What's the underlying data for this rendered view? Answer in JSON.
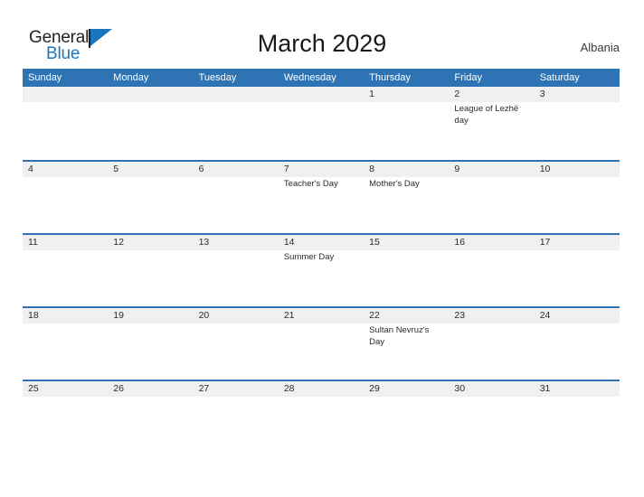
{
  "brand": {
    "name_part1": "General",
    "name_part2": "Blue",
    "logo_icon": "flag-triangle-icon",
    "color_dark": "#231f20",
    "color_blue": "#1a76bc"
  },
  "header": {
    "title": "March 2029",
    "country": "Albania",
    "accent_color": "#2e74b5",
    "band_color": "#f0f0f0"
  },
  "calendar": {
    "month": "March",
    "year": "2029",
    "weekday_headers": [
      "Sunday",
      "Monday",
      "Tuesday",
      "Wednesday",
      "Thursday",
      "Friday",
      "Saturday"
    ],
    "weeks": [
      {
        "days": [
          {
            "date": "",
            "event": ""
          },
          {
            "date": "",
            "event": ""
          },
          {
            "date": "",
            "event": ""
          },
          {
            "date": "",
            "event": ""
          },
          {
            "date": "1",
            "event": ""
          },
          {
            "date": "2",
            "event": "League of Lezhë day"
          },
          {
            "date": "3",
            "event": ""
          }
        ]
      },
      {
        "days": [
          {
            "date": "4",
            "event": ""
          },
          {
            "date": "5",
            "event": ""
          },
          {
            "date": "6",
            "event": ""
          },
          {
            "date": "7",
            "event": "Teacher's Day"
          },
          {
            "date": "8",
            "event": "Mother's Day"
          },
          {
            "date": "9",
            "event": ""
          },
          {
            "date": "10",
            "event": ""
          }
        ]
      },
      {
        "days": [
          {
            "date": "11",
            "event": ""
          },
          {
            "date": "12",
            "event": ""
          },
          {
            "date": "13",
            "event": ""
          },
          {
            "date": "14",
            "event": "Summer Day"
          },
          {
            "date": "15",
            "event": ""
          },
          {
            "date": "16",
            "event": ""
          },
          {
            "date": "17",
            "event": ""
          }
        ]
      },
      {
        "days": [
          {
            "date": "18",
            "event": ""
          },
          {
            "date": "19",
            "event": ""
          },
          {
            "date": "20",
            "event": ""
          },
          {
            "date": "21",
            "event": ""
          },
          {
            "date": "22",
            "event": "Sultan Nevruz's Day"
          },
          {
            "date": "23",
            "event": ""
          },
          {
            "date": "24",
            "event": ""
          }
        ]
      },
      {
        "days": [
          {
            "date": "25",
            "event": ""
          },
          {
            "date": "26",
            "event": ""
          },
          {
            "date": "27",
            "event": ""
          },
          {
            "date": "28",
            "event": ""
          },
          {
            "date": "29",
            "event": ""
          },
          {
            "date": "30",
            "event": ""
          },
          {
            "date": "31",
            "event": ""
          }
        ]
      }
    ]
  }
}
